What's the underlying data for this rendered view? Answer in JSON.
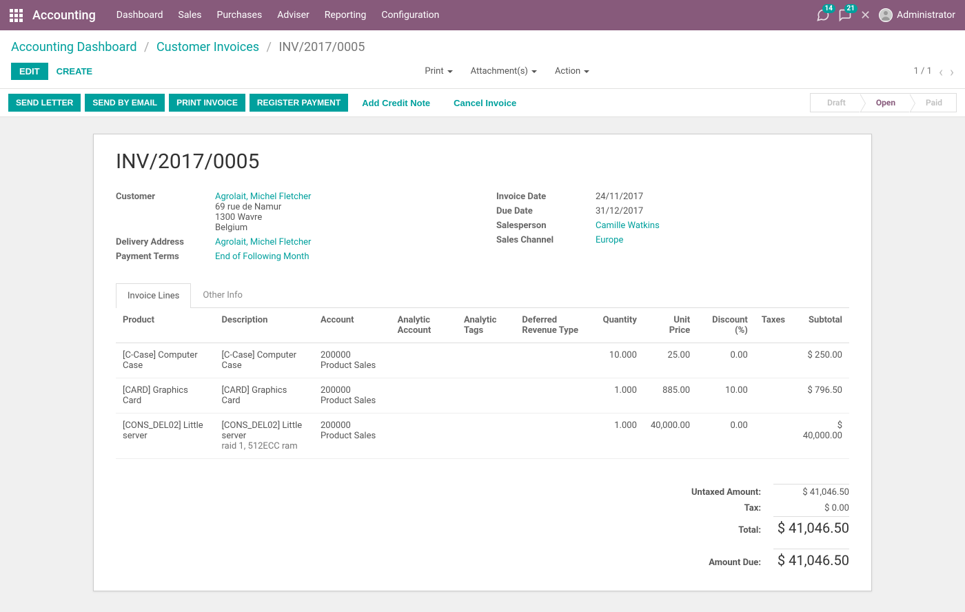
{
  "nav": {
    "brand": "Accounting",
    "items": [
      "Dashboard",
      "Sales",
      "Purchases",
      "Adviser",
      "Reporting",
      "Configuration"
    ],
    "badge1": "14",
    "badge2": "21",
    "user": "Administrator"
  },
  "breadcrumb": {
    "a": "Accounting Dashboard",
    "b": "Customer Invoices",
    "c": "INV/2017/0005"
  },
  "toolbar": {
    "edit": "Edit",
    "create": "Create",
    "print": "Print",
    "attachments": "Attachment(s)",
    "action": "Action",
    "pager": "1 / 1"
  },
  "actions": {
    "send_letter": "Send Letter",
    "send_email": "Send by Email",
    "print_invoice": "Print Invoice",
    "register_payment": "Register Payment",
    "add_credit_note": "Add Credit Note",
    "cancel_invoice": "Cancel Invoice"
  },
  "status": {
    "draft": "Draft",
    "open": "Open",
    "paid": "Paid"
  },
  "invoice": {
    "number": "INV/2017/0005",
    "customer_label": "Customer",
    "customer_name": "Agrolait, Michel Fletcher",
    "customer_addr1": "69 rue de Namur",
    "customer_addr2": "1300 Wavre",
    "customer_country": "Belgium",
    "delivery_label": "Delivery Address",
    "delivery_value": "Agrolait, Michel Fletcher",
    "terms_label": "Payment Terms",
    "terms_value": "End of Following Month",
    "invdate_label": "Invoice Date",
    "invdate_value": "24/11/2017",
    "duedate_label": "Due Date",
    "duedate_value": "31/12/2017",
    "salesperson_label": "Salesperson",
    "salesperson_value": "Camille Watkins",
    "channel_label": "Sales Channel",
    "channel_value": "Europe"
  },
  "tabs": {
    "lines": "Invoice Lines",
    "other": "Other Info"
  },
  "table": {
    "headers": {
      "product": "Product",
      "description": "Description",
      "account": "Account",
      "analytic_account": "Analytic Account",
      "analytic_tags": "Analytic Tags",
      "deferred": "Deferred Revenue Type",
      "quantity": "Quantity",
      "unit_price": "Unit Price",
      "discount": "Discount (%)",
      "taxes": "Taxes",
      "subtotal": "Subtotal"
    },
    "rows": [
      {
        "product": "[C-Case] Computer Case",
        "description": "[C-Case] Computer Case",
        "desc_sub": "",
        "account": "200000 Product Sales",
        "qty": "10.000",
        "price": "25.00",
        "disc": "0.00",
        "subtotal": "$ 250.00"
      },
      {
        "product": "[CARD] Graphics Card",
        "description": "[CARD] Graphics Card",
        "desc_sub": "",
        "account": "200000 Product Sales",
        "qty": "1.000",
        "price": "885.00",
        "disc": "10.00",
        "subtotal": "$ 796.50"
      },
      {
        "product": "[CONS_DEL02] Little server",
        "description": "[CONS_DEL02] Little server",
        "desc_sub": "raid 1, 512ECC ram",
        "account": "200000 Product Sales",
        "qty": "1.000",
        "price": "40,000.00",
        "disc": "0.00",
        "subtotal": "$ 40,000.00"
      }
    ]
  },
  "totals": {
    "untaxed_label": "Untaxed Amount:",
    "untaxed_value": "$ 41,046.50",
    "tax_label": "Tax:",
    "tax_value": "$ 0.00",
    "total_label": "Total:",
    "total_value": "$ 41,046.50",
    "due_label": "Amount Due:",
    "due_value": "$ 41,046.50"
  }
}
